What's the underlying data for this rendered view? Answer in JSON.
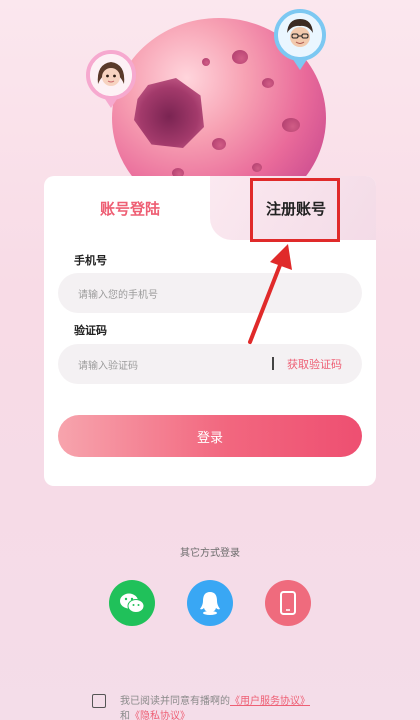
{
  "tabs": {
    "login": "账号登陆",
    "register": "注册账号"
  },
  "form": {
    "phone_label": "手机号",
    "phone_placeholder": "请输入您的手机号",
    "code_label": "验证码",
    "code_placeholder": "请输入验证码",
    "get_code": "获取验证码",
    "login_button": "登录"
  },
  "other": {
    "title": "其它方式登录",
    "methods": [
      "wechat-icon",
      "qq-icon",
      "phone-icon"
    ]
  },
  "agreement": {
    "prefix": "我已阅读并同意有播啊的",
    "user_agreement": "《用户服务协议》",
    "connector": "和",
    "privacy": "《隐私协议》"
  },
  "colors": {
    "accent": "#ee5f74",
    "wechat": "#20c15a",
    "qq": "#39a7f4",
    "phone": "#ef6b7d",
    "annotation": "#e02a2a"
  }
}
